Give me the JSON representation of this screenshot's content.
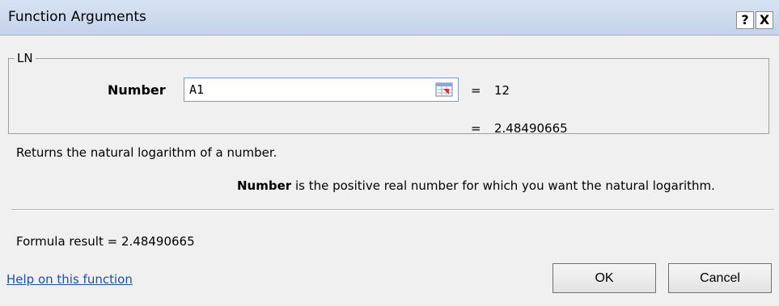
{
  "window": {
    "title": "Function Arguments",
    "help_glyph": "?",
    "close_glyph": "X"
  },
  "function": {
    "name": "LN",
    "argument_label": "Number",
    "argument_value": "A1",
    "argument_eval": "12",
    "equals": "=",
    "result_preview": "2.48490665"
  },
  "description": "Returns the natural logarithm of a number.",
  "parameter_help": {
    "name": "Number",
    "text": "is the positive real number for which you want the natural logarithm."
  },
  "formula_result": {
    "label": "Formula result =",
    "value": "2.48490665"
  },
  "help_link": "Help on this function",
  "buttons": {
    "ok": "OK",
    "cancel": "Cancel"
  },
  "icons": {
    "ref_button": "collapse-dialog-icon"
  }
}
